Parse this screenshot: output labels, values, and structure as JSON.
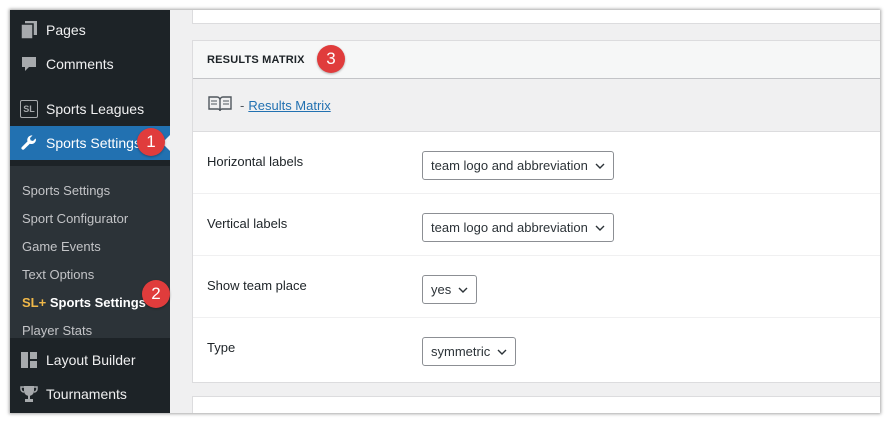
{
  "sidebar": {
    "menu": [
      {
        "label": "Pages",
        "icon": "pages-icon"
      },
      {
        "label": "Comments",
        "icon": "comments-icon"
      },
      {
        "label": "Sports Leagues",
        "icon": "sl-badge-icon",
        "badge": "SL"
      },
      {
        "label": "Sports Settings",
        "icon": "wrench-icon",
        "active": true
      },
      {
        "label": "Layout Builder",
        "icon": "layout-icon"
      },
      {
        "label": "Tournaments",
        "icon": "trophy-icon"
      }
    ],
    "submenu": [
      {
        "label": "Sports Settings"
      },
      {
        "label": "Sport Configurator"
      },
      {
        "label": "Game Events"
      },
      {
        "label": "Text Options"
      },
      {
        "prefix": "SL+",
        "label": "Sports Settings",
        "current": true
      },
      {
        "label": "Player Stats"
      }
    ]
  },
  "callouts": [
    "1",
    "2",
    "3"
  ],
  "panel": {
    "title": "RESULTS MATRIX",
    "info_dash": "-",
    "info_link": "Results Matrix",
    "rows": [
      {
        "label": "Horizontal labels",
        "value": "team logo and abbreviation"
      },
      {
        "label": "Vertical labels",
        "value": "team logo and abbreviation"
      },
      {
        "label": "Show team place",
        "value": "yes"
      },
      {
        "label": "Type",
        "value": "symmetric"
      }
    ]
  },
  "colors": {
    "sidebar_bg": "#1d2327",
    "active_bg": "#2271b1",
    "callout": "#e03c3c",
    "sl_prefix": "#f0b849",
    "link": "#2271b1"
  }
}
